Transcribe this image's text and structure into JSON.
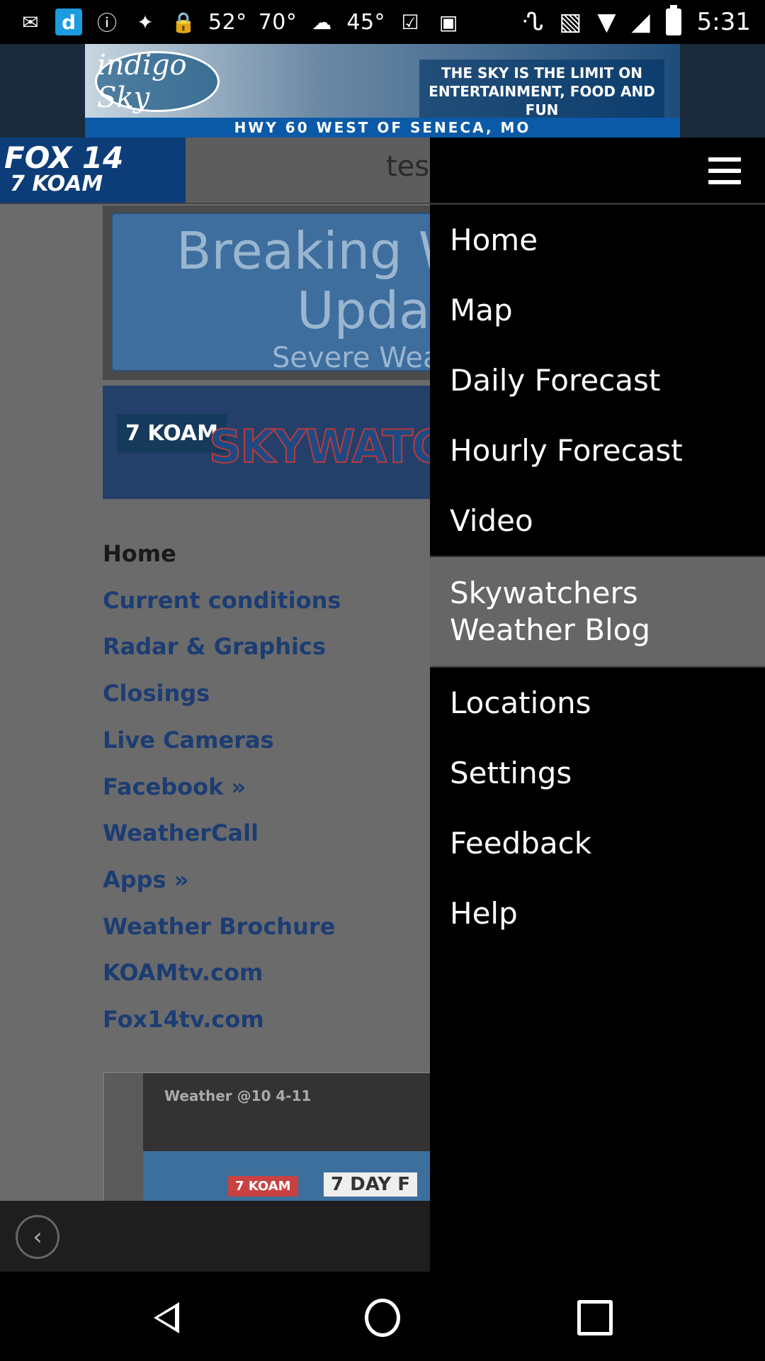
{
  "status_bar": {
    "temp1": "52°",
    "temp2": "70°",
    "temp3": "45°",
    "time": "5:31",
    "icons": [
      "message-icon",
      "dictionary-icon",
      "alert-icon",
      "satellite-icon",
      "lock-icon",
      "cloud-icon",
      "inbox-icon",
      "briefcase-icon",
      "bluetooth-icon",
      "vibrate-icon",
      "wifi-icon",
      "signal-icon",
      "battery-icon"
    ]
  },
  "ad": {
    "logo_text": "indigo Sky",
    "headline": "THE SKY IS THE LIMIT ON ENTERTAINMENT, FOOD AND FUN",
    "strip": "HWY 60 WEST OF SENECA, MO"
  },
  "header": {
    "logo_top": "FOX 14",
    "logo_bottom": "7 KOAM",
    "search_text": "tes"
  },
  "banner": {
    "title_line1": "Breaking W",
    "title_line2": "Updat",
    "subtitle": "Severe Wea"
  },
  "skywatch": {
    "logo": "7 KOAM",
    "text": "SKYWATC"
  },
  "links": [
    "Home",
    "Current conditions",
    "Radar & Graphics",
    "Closings",
    "Live Cameras",
    "Facebook »",
    "WeatherCall",
    "Apps »",
    "Weather Brochure",
    "KOAMtv.com",
    "Fox14tv.com"
  ],
  "video": {
    "title": "Weather @10 4-11",
    "badge": "7 KOAM",
    "label": "7 DAY F"
  },
  "drawer": {
    "items": [
      "Home",
      "Map",
      "Daily Forecast",
      "Hourly Forecast",
      "Video"
    ],
    "highlight_line1": "Skywatchers",
    "highlight_line2": "Weather Blog",
    "items_after": [
      "Locations",
      "Settings",
      "Feedback",
      "Help"
    ]
  }
}
